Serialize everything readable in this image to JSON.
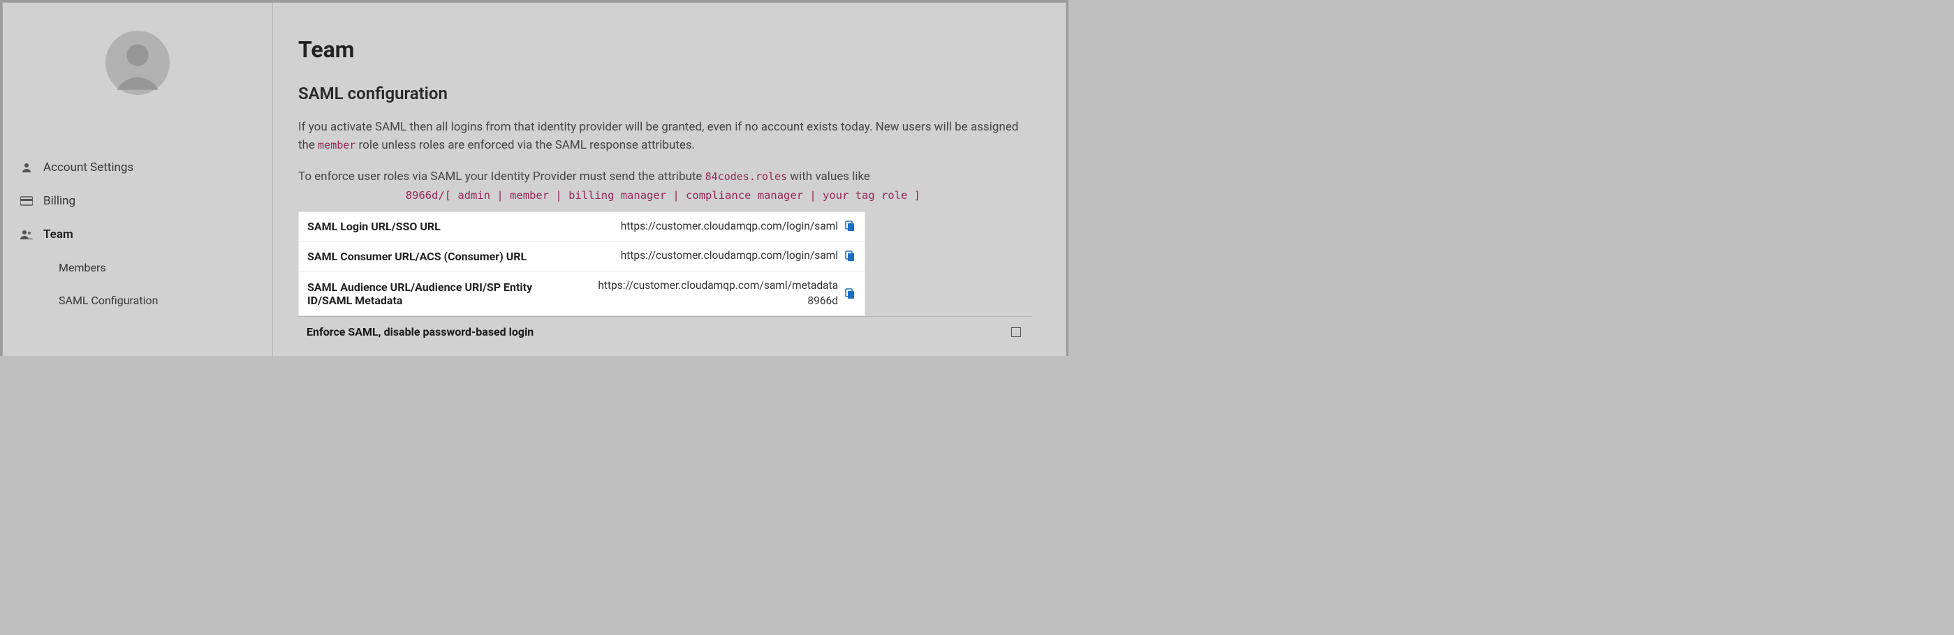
{
  "sidebar": {
    "items": [
      {
        "label": "Account Settings",
        "icon": "user"
      },
      {
        "label": "Billing",
        "icon": "card"
      },
      {
        "label": "Team",
        "icon": "users"
      }
    ],
    "subitems": [
      {
        "label": "Members"
      },
      {
        "label": "SAML Configuration"
      }
    ]
  },
  "main": {
    "page_title": "Team",
    "section_title": "SAML configuration",
    "desc_line1_pre": "If you activate SAML then all logins from that identity provider will be granted, even if no account exists today. New users will be assigned the ",
    "desc_line1_code": "member",
    "desc_line1_post": " role unless roles are enforced via the SAML response attributes.",
    "desc_line2_pre": "To enforce user roles via SAML your Identity Provider must send the attribute ",
    "desc_line2_code": "84codes.roles",
    "desc_line2_post": " with values like",
    "roles_example": "8966d/[ admin | member | billing manager | compliance manager | your tag role ]",
    "rows": [
      {
        "label": "SAML Login URL/SSO URL",
        "value": "https://customer.cloudamqp.com/login/saml"
      },
      {
        "label": "SAML Consumer URL/ACS (Consumer) URL",
        "value": "https://customer.cloudamqp.com/login/saml"
      },
      {
        "label": "SAML Audience URL/Audience URI/SP Entity ID/SAML Metadata",
        "value": "https://customer.cloudamqp.com/saml/metadata 8966d"
      }
    ],
    "enforce_label": "Enforce SAML, disable password-based login"
  }
}
